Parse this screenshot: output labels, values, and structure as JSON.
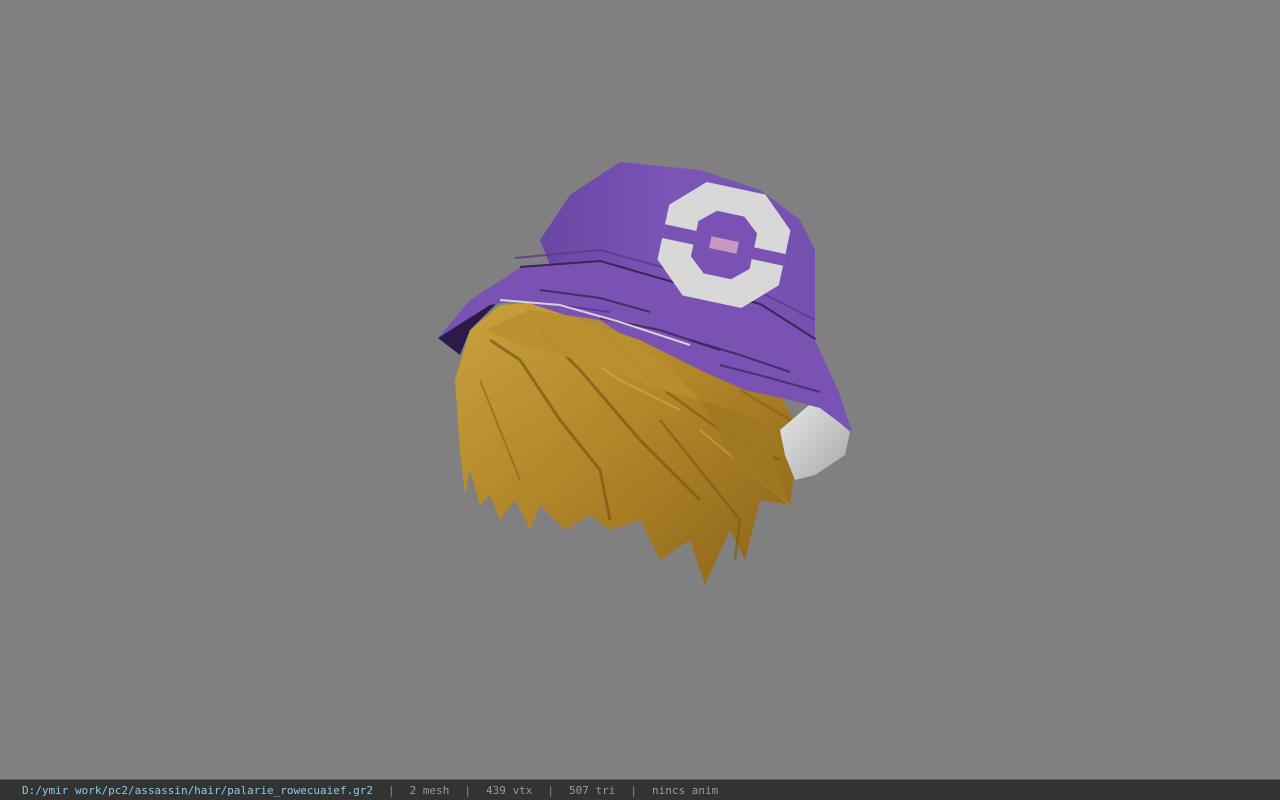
{
  "viewport": {
    "background": "#808080",
    "model": {
      "hat_color": "#7a52b4",
      "hat_shadow": "#3a2458",
      "hair_color": "#b58a2a",
      "emblem_color": "#d8d8d8"
    }
  },
  "statusbar": {
    "path": "D:/ymir work/pc2/assassin/hair/palarie_rowecuaief.gr2",
    "separator": "|",
    "mesh": "2 mesh",
    "vtx": "439 vtx",
    "tri": "507 tri",
    "anim": "nincs anim"
  }
}
